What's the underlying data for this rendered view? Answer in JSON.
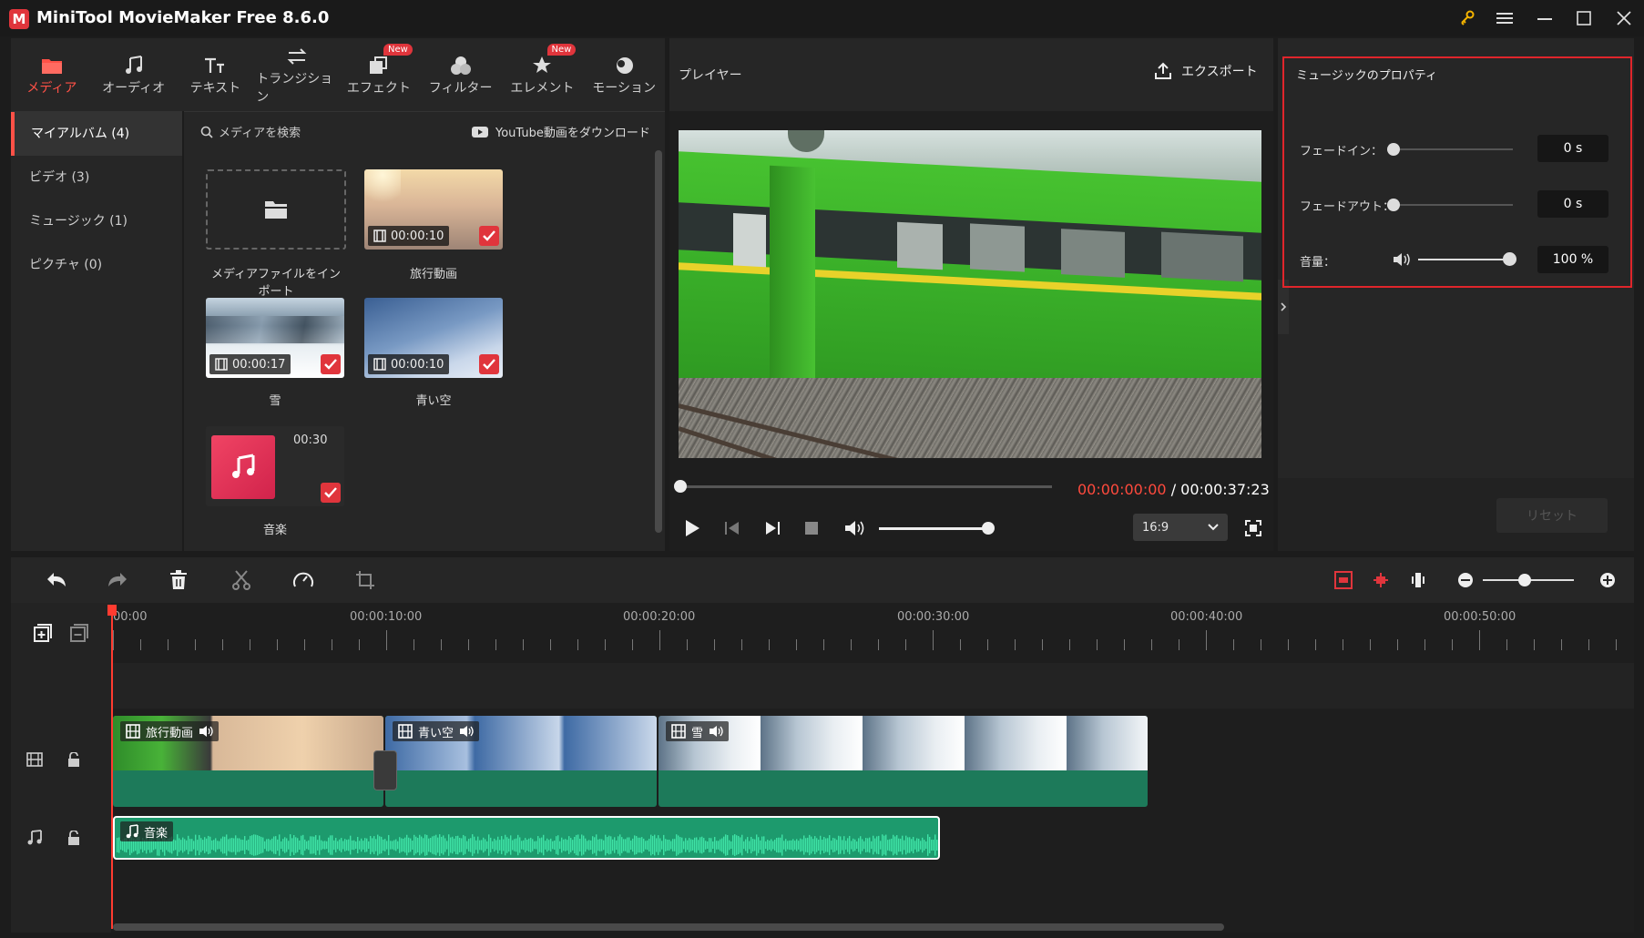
{
  "app": {
    "title": "MiniTool MovieMaker Free 8.6.0",
    "logo_text": "M"
  },
  "toolbar": {
    "tabs": [
      {
        "label": "メディア",
        "icon": "folder-icon",
        "active": true
      },
      {
        "label": "オーディオ",
        "icon": "music-icon"
      },
      {
        "label": "テキスト",
        "icon": "text-icon"
      },
      {
        "label": "トランジション",
        "icon": "transition-icon"
      },
      {
        "label": "エフェクト",
        "icon": "effect-icon",
        "badge": "New"
      },
      {
        "label": "フィルター",
        "icon": "filter-icon"
      },
      {
        "label": "エレメント",
        "icon": "element-icon",
        "badge": "New"
      },
      {
        "label": "モーション",
        "icon": "motion-icon"
      }
    ]
  },
  "sidebar": {
    "items": [
      {
        "label": "マイアルバム (4)",
        "active": true
      },
      {
        "label": "ビデオ (3)"
      },
      {
        "label": "ミュージック (1)"
      },
      {
        "label": "ピクチャ (0)"
      }
    ]
  },
  "media": {
    "search_placeholder": "メディアを検索",
    "youtube_label": "YouTube動画をダウンロード",
    "import_label": "メディアファイルをインポート",
    "items": [
      {
        "name": "旅行動画",
        "duration": "00:00:10"
      },
      {
        "name": "雪",
        "duration": "00:00:17"
      },
      {
        "name": "青い空",
        "duration": "00:00:10"
      },
      {
        "name": "音楽",
        "duration": "00:30"
      }
    ]
  },
  "player": {
    "title": "プレイヤー",
    "export_label": "エクスポート",
    "current_time": "00:00:00:00",
    "separator": " / ",
    "total_time": "00:00:37:23",
    "aspect": "16:9",
    "progress": 0,
    "volume": 1.0
  },
  "properties": {
    "title": "ミュージックのプロパティ",
    "fade_in_label": "フェードイン：",
    "fade_in_value": "0 s",
    "fade_out_label": "フェードアウト：",
    "fade_out_value": "0 s",
    "volume_label": "音量：",
    "volume_value": "100 %",
    "reset_label": "リセット"
  },
  "timeline": {
    "ruler": [
      "00:00",
      "00:00:10:00",
      "00:00:20:00",
      "00:00:30:00",
      "00:00:40:00",
      "00:00:50:00"
    ],
    "clips": [
      {
        "name": "旅行動画"
      },
      {
        "name": "青い空"
      },
      {
        "name": "雪"
      }
    ],
    "audio_clip": {
      "name": "音楽"
    }
  },
  "colors": {
    "accent": "#ff5147",
    "clip": "#1d7a5a",
    "highlight": "#e0353c"
  }
}
